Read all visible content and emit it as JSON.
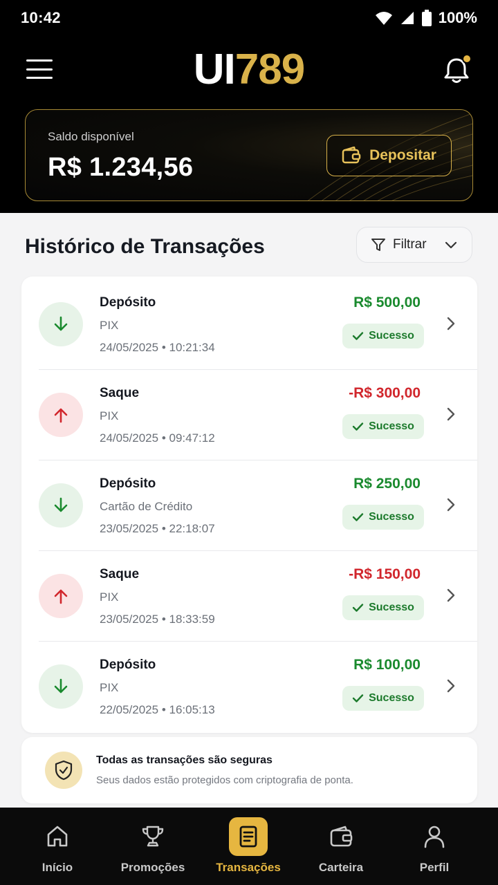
{
  "status_bar": {
    "time": "10:42",
    "battery": "100%"
  },
  "header": {
    "logo_white": "UI",
    "logo_gold": "789",
    "menu_icon": "hamburger-menu-icon",
    "notification_icon": "bell-icon"
  },
  "balance": {
    "label": "Saldo disponível",
    "value": "R$ 1.234,56",
    "deposit_label": "Depositar"
  },
  "history": {
    "title": "Histórico de Transações",
    "filter_label": "Filtrar",
    "transactions": [
      {
        "type": "Depósito",
        "method": "PIX",
        "date": "24/05/2025",
        "time": "10:21:34",
        "amount": "R$ 500,00",
        "status": "Sucesso",
        "direction": "in"
      },
      {
        "type": "Saque",
        "method": "PIX",
        "date": "24/05/2025",
        "time": "09:47:12",
        "amount": "-R$ 300,00",
        "status": "Sucesso",
        "direction": "out"
      },
      {
        "type": "Depósito",
        "method": "Cartão de Crédito",
        "date": "23/05/2025",
        "time": "22:18:07",
        "amount": "R$ 250,00",
        "status": "Sucesso",
        "direction": "in"
      },
      {
        "type": "Saque",
        "method": "PIX",
        "date": "23/05/2025",
        "time": "18:33:59",
        "amount": "-R$ 150,00",
        "status": "Sucesso",
        "direction": "out"
      },
      {
        "type": "Depósito",
        "method": "PIX",
        "date": "22/05/2025",
        "time": "16:05:13",
        "amount": "R$ 100,00",
        "status": "Sucesso",
        "direction": "in"
      }
    ]
  },
  "security": {
    "title": "Todas as transações são seguras",
    "description": "Seus dados estão protegidos com criptografia de ponta."
  },
  "bottom_nav": [
    {
      "label": "Início",
      "icon": "home-icon",
      "active": false
    },
    {
      "label": "Promoções",
      "icon": "trophy-icon",
      "active": false
    },
    {
      "label": "Transações",
      "icon": "document-icon",
      "active": true
    },
    {
      "label": "Carteira",
      "icon": "wallet-icon",
      "active": false
    },
    {
      "label": "Perfil",
      "icon": "user-icon",
      "active": false
    }
  ],
  "colors": {
    "gold": "#d9b24a",
    "positive": "#1a8a2e",
    "negative": "#d1262c"
  }
}
